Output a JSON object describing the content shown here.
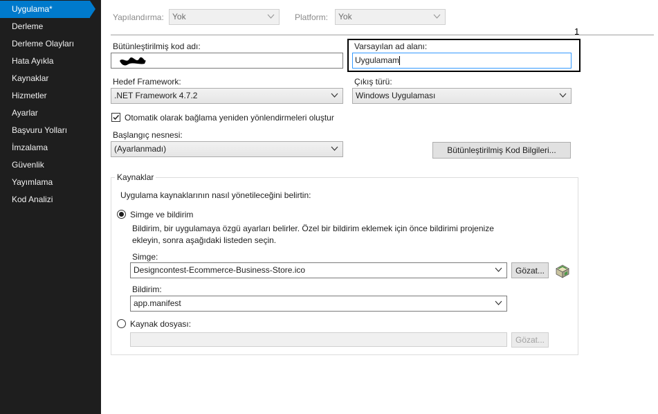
{
  "sidebar": {
    "items": [
      {
        "label": "Uygulama*"
      },
      {
        "label": "Derleme"
      },
      {
        "label": "Derleme Olayları"
      },
      {
        "label": "Hata Ayıkla"
      },
      {
        "label": "Kaynaklar"
      },
      {
        "label": "Hizmetler"
      },
      {
        "label": "Ayarlar"
      },
      {
        "label": "Başvuru Yolları"
      },
      {
        "label": "İmzalama"
      },
      {
        "label": "Güvenlik"
      },
      {
        "label": "Yayımlama"
      },
      {
        "label": "Kod Analizi"
      }
    ]
  },
  "toolbar": {
    "configuration_label": "Yapılandırma:",
    "configuration_value": "Yok",
    "platform_label": "Platform:",
    "platform_value": "Yok"
  },
  "annotation": {
    "number": "1"
  },
  "form": {
    "assembly_name_label": "Bütünleştirilmiş kod adı:",
    "default_namespace_label": "Varsayılan ad alanı:",
    "default_namespace_value": "Uygulamam",
    "target_framework_label": "Hedef Framework:",
    "target_framework_value": ".NET Framework 4.7.2",
    "output_type_label": "Çıkış türü:",
    "output_type_value": "Windows Uygulaması",
    "auto_redirect_label": "Otomatik olarak bağlama yeniden yönlendirmeleri oluştur",
    "auto_redirect_checked": true,
    "startup_object_label": "Başlangıç nesnesi:",
    "startup_object_value": "(Ayarlanmadı)",
    "assembly_info_button": "Bütünleştirilmiş Kod Bilgileri..."
  },
  "resources": {
    "group_title": "Kaynaklar",
    "description": "Uygulama kaynaklarının nasıl yönetileceğini belirtin:",
    "icon_manifest_option": "Simge ve bildirim",
    "icon_manifest_help_line1": "Bildirim, bir uygulamaya özgü ayarları belirler. Özel bir bildirim eklemek için önce bildirimi projenize",
    "icon_manifest_help_line2": "ekleyin, sonra aşağıdaki listeden seçin.",
    "icon_label": "Simge:",
    "icon_value": "Designcontest-Ecommerce-Business-Store.ico",
    "browse_button": "Gözat...",
    "manifest_label": "Bildirim:",
    "manifest_value": "app.manifest",
    "resource_file_option": "Kaynak dosyası:",
    "resource_file_value": "",
    "browse_button_disabled": "Gözat..."
  }
}
